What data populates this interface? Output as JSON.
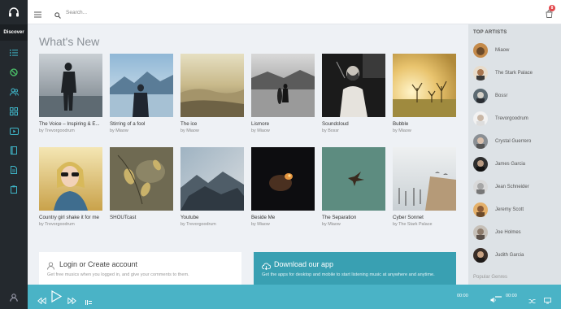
{
  "sidebar": {
    "discover_label": "Discover",
    "icons": [
      "headphones-icon",
      "list-icon",
      "block-icon",
      "users-icon",
      "grid-icon",
      "video-icon",
      "book-icon",
      "file-icon",
      "clipboard-icon"
    ]
  },
  "topbar": {
    "search_placeholder": "Search...",
    "cart_badge": "8"
  },
  "main": {
    "title": "What's New",
    "cards": [
      {
        "title": "The Voice – Inspiring & E...",
        "sub": "by Trevorgoodrum"
      },
      {
        "title": "Stirring of a fool",
        "sub": "by Miaow"
      },
      {
        "title": "The ice",
        "sub": "by Miaow"
      },
      {
        "title": "Lismore",
        "sub": "by Miaow"
      },
      {
        "title": "Soundcloud",
        "sub": "by Bossr"
      },
      {
        "title": "Bubble",
        "sub": "by Miaow"
      },
      {
        "title": "Country girl shake it for me",
        "sub": "by Trevorgoodrum"
      },
      {
        "title": "SHOUTcast",
        "sub": ""
      },
      {
        "title": "Youtube",
        "sub": "by Trevorgoodrum"
      },
      {
        "title": "Beside Me",
        "sub": "by Miaow"
      },
      {
        "title": "The Separation",
        "sub": "by Miaow"
      },
      {
        "title": "Cyber Sonnet",
        "sub": "by The Stark Palace"
      }
    ],
    "login_box": {
      "title": "Login or Create account",
      "text": "Get free musics when you logged in, and give your comments to them."
    },
    "download_box": {
      "title": "Download our app",
      "text": "Get the apps for desktop and mobile to start listening music at anywhere and anytime."
    }
  },
  "right_panel": {
    "title": "TOP ARTISTS",
    "artists": [
      "Miaow",
      "The Stark Palace",
      "Bossr",
      "Trevorgoodrum",
      "Crystal Guerrero",
      "James Garcia",
      "Jean Schneider",
      "Jeremy Scott",
      "Joe Holmes",
      "Judith Garcia"
    ],
    "genres_label": "Popular Genres"
  },
  "player": {
    "time_current": "00:00",
    "time_total": "00:00"
  },
  "colors": {
    "sidebar": "#24292e",
    "accent": "#4ab3c6",
    "download_box": "#39a0b2",
    "badge": "#e2474b"
  }
}
